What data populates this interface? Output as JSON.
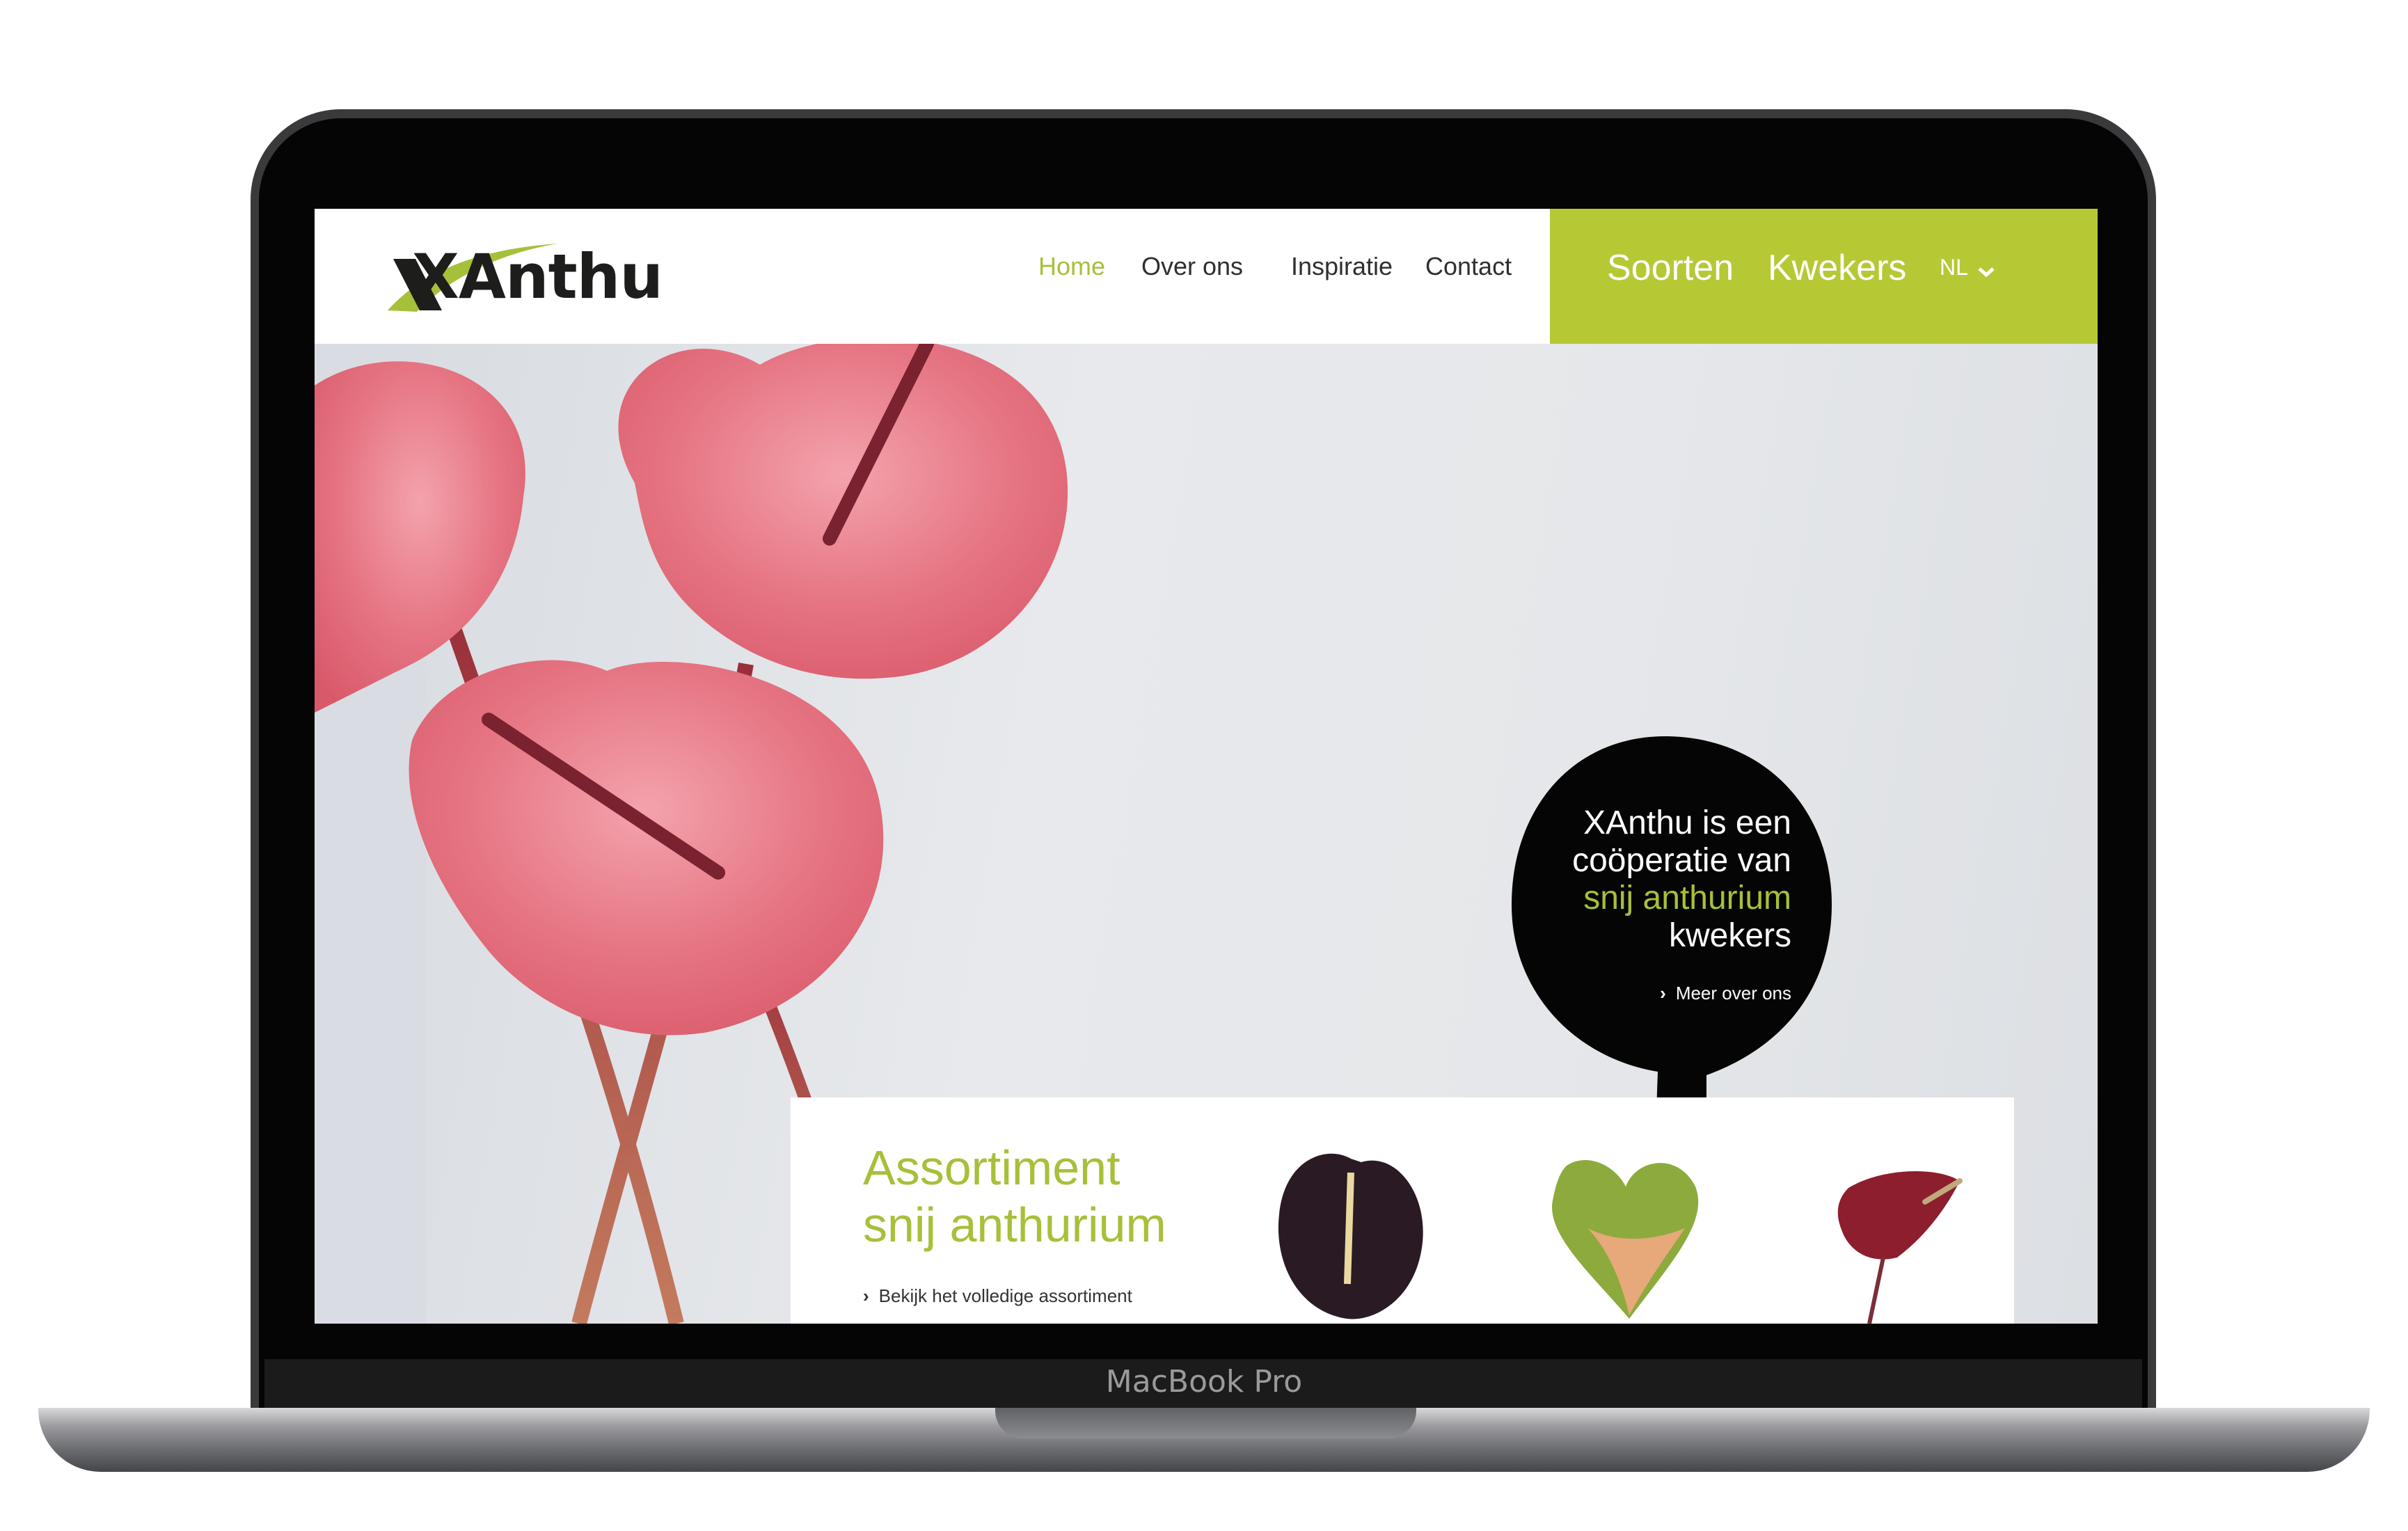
{
  "device": {
    "brand_label": "MacBook Pro"
  },
  "site": {
    "logo_text": "XAnthu",
    "nav": [
      {
        "label": "Home",
        "active": true
      },
      {
        "label": "Over ons"
      },
      {
        "label": "Inspiratie"
      },
      {
        "label": "Contact"
      }
    ],
    "primary_nav": [
      {
        "label": "Soorten"
      },
      {
        "label": "Kwekers"
      }
    ],
    "language": {
      "selected": "NL",
      "icon": "chevron-down-icon"
    },
    "accent_color": "#b6c834",
    "bubble": {
      "line1": "XAnthu is een",
      "line2": "coöperatie van",
      "line3_highlight": "snij anthurium",
      "line4": "kwekers",
      "link": "Meer over ons"
    },
    "assortment": {
      "title_line1": "Assortiment",
      "title_line2": "snij anthurium",
      "link": "Bekijk het volledige assortiment"
    }
  }
}
